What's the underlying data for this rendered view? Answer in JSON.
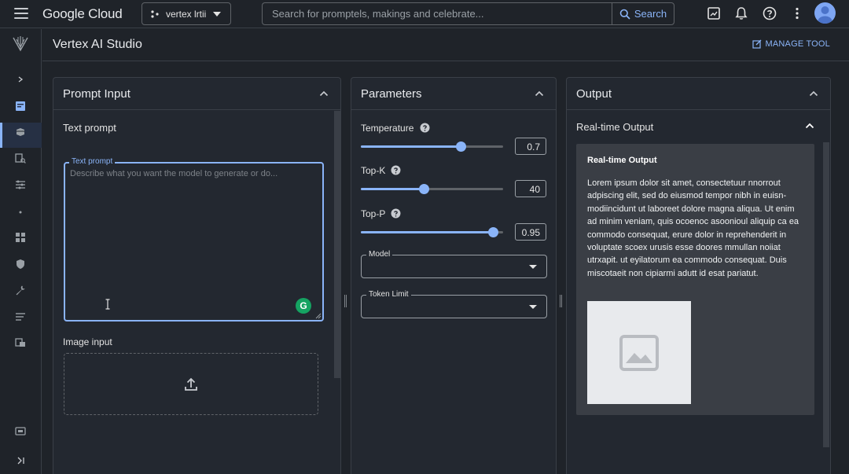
{
  "topbar": {
    "logo": "Google Cloud",
    "project": "vertex lrtii",
    "search_placeholder": "Search for promptels, makings and celebrate...",
    "search_button": "Search"
  },
  "subheader": {
    "title": "Vertex AI Studio",
    "manage_tool": "MANAGE TOOL"
  },
  "prompt_panel": {
    "title": "Prompt Input",
    "text_prompt_label": "Text prompt",
    "textarea_legend": "Text prompt",
    "textarea_placeholder": "Describe what you want the model to generate or do...",
    "grammarly": "G",
    "image_input_label": "Image input"
  },
  "parameters_panel": {
    "title": "Parameters",
    "temperature": {
      "label": "Temperature",
      "value": "0.7",
      "fraction": 0.7
    },
    "top_k": {
      "label": "Top-K",
      "value": "40",
      "fraction": 0.44
    },
    "top_p": {
      "label": "Top-P",
      "value": "0.95",
      "fraction": 0.93
    },
    "model_label": "Model",
    "token_limit_label": "Token Limit"
  },
  "output_panel": {
    "title": "Output",
    "realtime_header": "Real-time Output",
    "card_title": "Real-time Output",
    "card_text": "Lorem ipsum dolor sit amet, consectetuur nnorrout adpiscing elit, sed do eiusmod tempor nibh in euisn-modiincidunt ut laboreet dolore magna aliqua. Ut enim ad minim veniam, quis ocoenoc asoonioul aliquip ca ea commodo consequat, erure dolor in reprehenderit in voluptate scoex urusis esse doores mmullan noiiat utrxapit. ut eyilatorum ea commodo consequat. Duis miscotaeit non cipiarmi adutt id esat pariatut."
  },
  "colors": {
    "accent": "#8ab4f8",
    "background": "#1f2329",
    "panel": "#232830",
    "grammarly": "#15a362"
  }
}
